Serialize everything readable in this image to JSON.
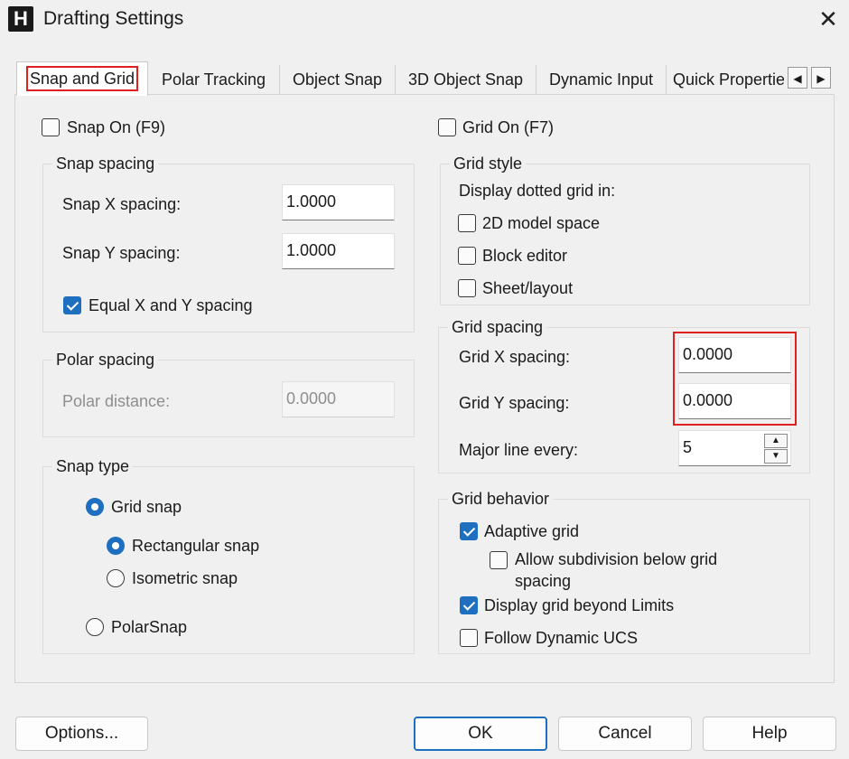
{
  "window": {
    "app_icon_letter": "H",
    "title": "Drafting Settings",
    "close_glyph": "✕"
  },
  "tabs": [
    {
      "label": "Snap and Grid"
    },
    {
      "label": "Polar Tracking"
    },
    {
      "label": "Object Snap"
    },
    {
      "label": "3D Object Snap"
    },
    {
      "label": "Dynamic Input"
    },
    {
      "label": "Quick Properties"
    }
  ],
  "tab_scroll": {
    "left": "◀",
    "right": "▶"
  },
  "snap_on": {
    "label": "Snap On (F9)",
    "checked": false
  },
  "grid_on": {
    "label": "Grid On (F7)",
    "checked": false
  },
  "snap_spacing": {
    "title": "Snap spacing",
    "x_label": "Snap X spacing:",
    "x_value": "1.0000",
    "y_label": "Snap Y spacing:",
    "y_value": "1.0000",
    "equal_label": "Equal X and Y spacing",
    "equal_checked": true
  },
  "polar_spacing": {
    "title": "Polar spacing",
    "distance_label": "Polar distance:",
    "distance_value": "0.0000"
  },
  "snap_type": {
    "title": "Snap type",
    "grid_snap": "Grid snap",
    "rectangular": "Rectangular snap",
    "isometric": "Isometric snap",
    "polar": "PolarSnap",
    "selected_type": "Grid snap",
    "selected_style": "Rectangular snap"
  },
  "grid_style": {
    "title": "Grid style",
    "caption": "Display dotted grid in:",
    "model_space": "2D model space",
    "block_editor": "Block editor",
    "sheet_layout": "Sheet/layout"
  },
  "grid_spacing": {
    "title": "Grid spacing",
    "x_label": "Grid X spacing:",
    "x_value": "0.0000",
    "y_label": "Grid Y spacing:",
    "y_value": "0.0000",
    "major_label": "Major line every:",
    "major_value": "5"
  },
  "grid_behavior": {
    "title": "Grid behavior",
    "adaptive": "Adaptive grid",
    "adaptive_checked": true,
    "subdivision_line1": "Allow subdivision below grid",
    "subdivision_line2": "spacing",
    "subdivision_checked": false,
    "beyond_limits": "Display grid beyond Limits",
    "beyond_checked": true,
    "follow_ucs": "Follow Dynamic UCS",
    "follow_checked": false
  },
  "buttons": {
    "options": "Options...",
    "ok": "OK",
    "cancel": "Cancel",
    "help": "Help"
  },
  "colors": {
    "accent": "#1f6fc0",
    "highlight": "#e02020",
    "background": "#f0f0f0"
  },
  "icons": {
    "app": "app-h-icon",
    "close": "close-icon",
    "spin_up": "spin-up-icon",
    "spin_down": "spin-down-icon"
  }
}
